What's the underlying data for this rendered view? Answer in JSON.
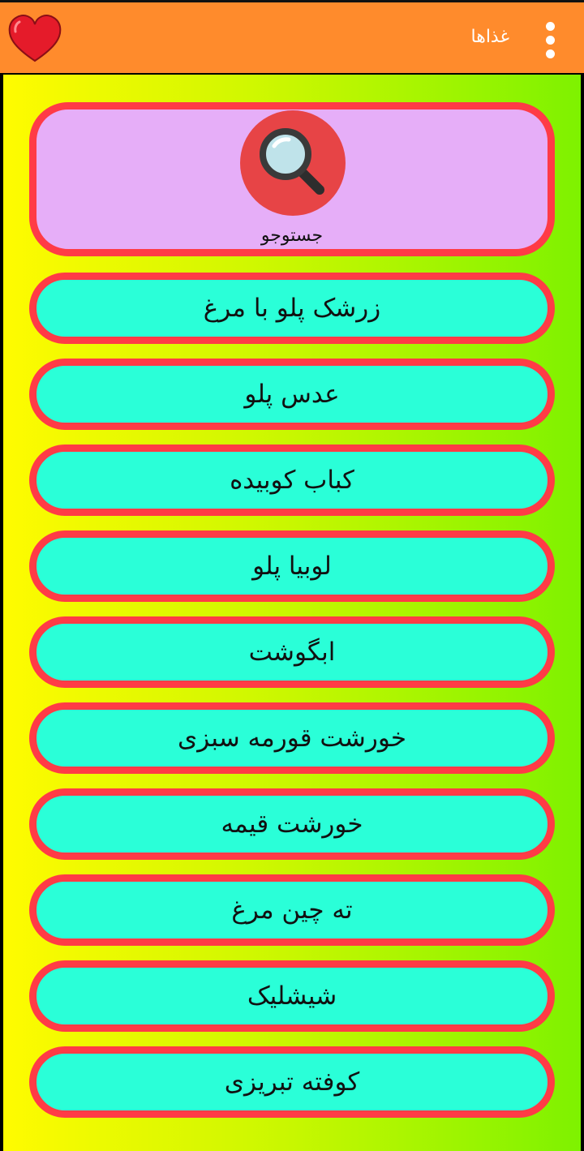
{
  "appbar": {
    "title": "غذاها",
    "menu_icon": "vertical-dots-icon",
    "favorite_icon": "heart-icon"
  },
  "search": {
    "label": "جستوجو",
    "icon": "magnifier-icon"
  },
  "foods": [
    {
      "label": "زرشک پلو با مرغ"
    },
    {
      "label": "عدس پلو"
    },
    {
      "label": "کباب کوبیده"
    },
    {
      "label": "لوبیا پلو"
    },
    {
      "label": "ابگوشت"
    },
    {
      "label": "خورشت قورمه سبزی"
    },
    {
      "label": "خورشت قیمه"
    },
    {
      "label": "ته چین مرغ"
    },
    {
      "label": "شیشلیک"
    },
    {
      "label": "کوفته تبریزی"
    }
  ],
  "colors": {
    "appbar": "#ff8b2c",
    "button_fill": "#2affd8",
    "button_border": "#ff3b46",
    "search_card_fill": "#e6aef8",
    "search_circle": "#e74446"
  }
}
